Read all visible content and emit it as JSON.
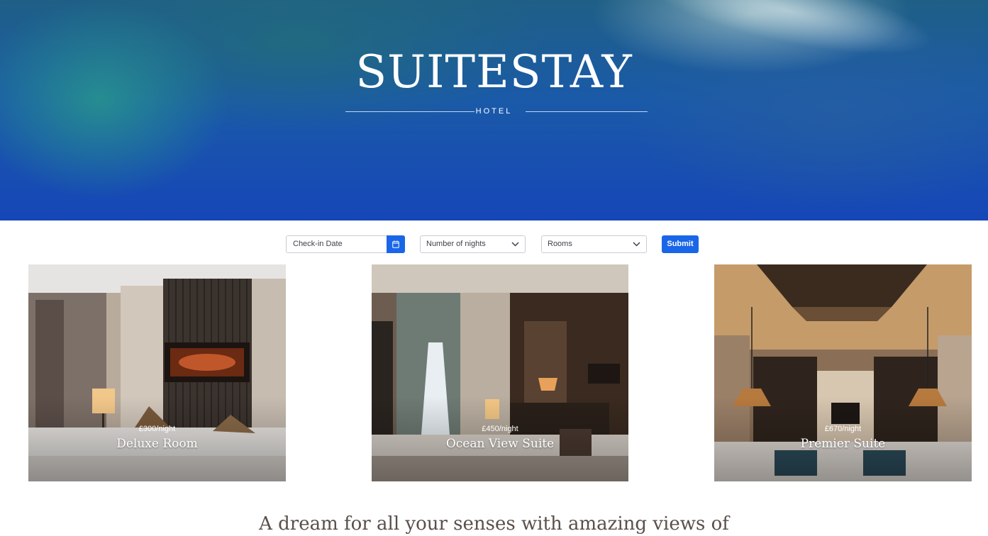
{
  "hero": {
    "title": "SUITESTAY",
    "subtitle": "HOTEL"
  },
  "booking": {
    "checkin_placeholder": "Check-in Date",
    "calendar_icon": "calendar-icon",
    "nights": {
      "selected": "Number of nights",
      "icon": "chevron-down-icon"
    },
    "rooms": {
      "selected": "Rooms",
      "icon": "chevron-down-icon"
    },
    "submit_label": "Submit",
    "accent_color": "#1a66e8"
  },
  "rooms": [
    {
      "price": "£300/night",
      "name": "Deluxe Room"
    },
    {
      "price": "£450/night",
      "name": "Ocean View Suite"
    },
    {
      "price": "£670/night",
      "name": "Premier Suite"
    }
  ],
  "tagline": "A dream for all your senses with amazing views of"
}
